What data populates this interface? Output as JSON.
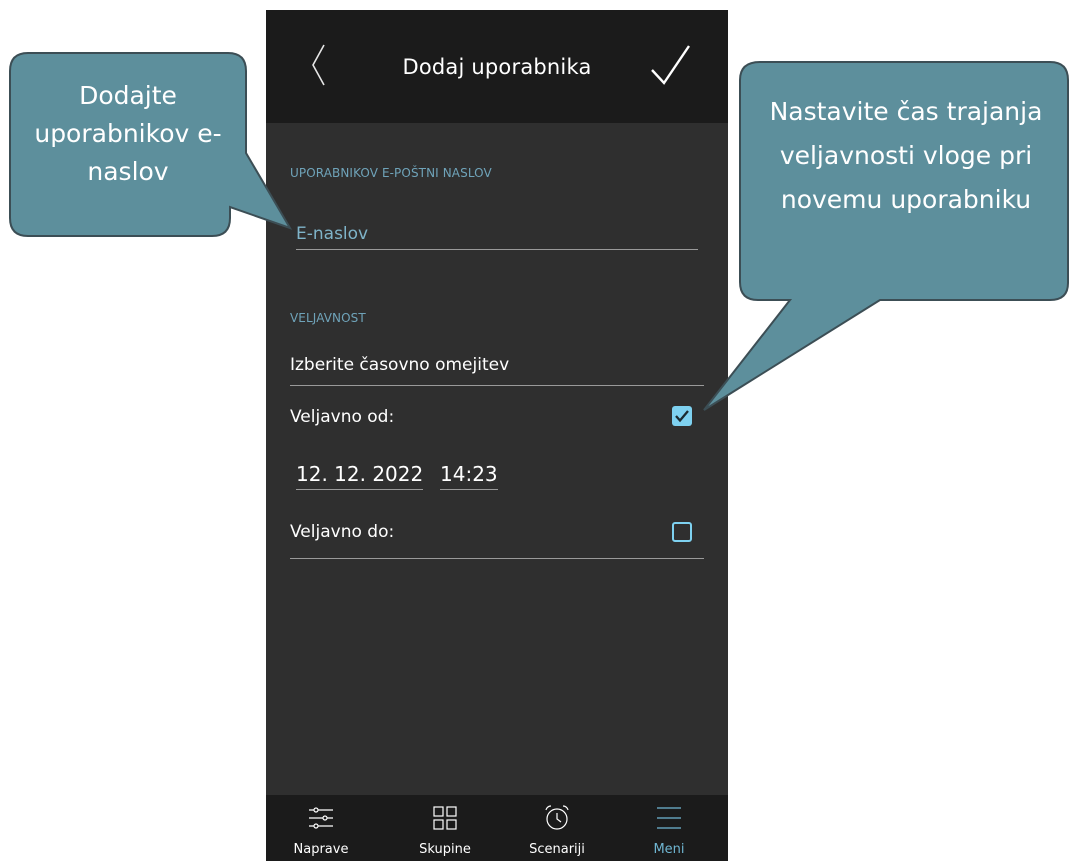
{
  "header": {
    "title": "Dodaj uporabnika"
  },
  "email_section": {
    "label": "UPORABNIKOV E-POŠTNI NASLOV",
    "placeholder": "E-naslov"
  },
  "validity_section": {
    "label": "VELJAVNOST",
    "select_label": "Izberite časovno omejitev",
    "valid_from_label": "Veljavno od:",
    "valid_from_checked": true,
    "valid_from_date": "12. 12. 2022",
    "valid_from_time": "14:23",
    "valid_to_label": "Veljavno do:",
    "valid_to_checked": false
  },
  "bottom_nav": {
    "items": [
      {
        "label": "Naprave",
        "icon": "sliders-icon"
      },
      {
        "label": "Skupine",
        "icon": "grid-icon"
      },
      {
        "label": "Scenariji",
        "icon": "alarm-clock-icon"
      },
      {
        "label": "Meni",
        "icon": "menu-icon",
        "active": true
      }
    ]
  },
  "callouts": {
    "left": "Dodajte uporabnikov e-naslov",
    "right": "Nastavite čas trajanja veljavnosti vloge pri novemu uporabniku"
  },
  "colors": {
    "header_bg": "#1b1b1b",
    "body_bg": "#2f2f2f",
    "accent": "#7ed1f0",
    "label_blue": "#6fa3b9",
    "callout_fill": "#5d8f9c",
    "callout_border": "#3c4e55"
  }
}
